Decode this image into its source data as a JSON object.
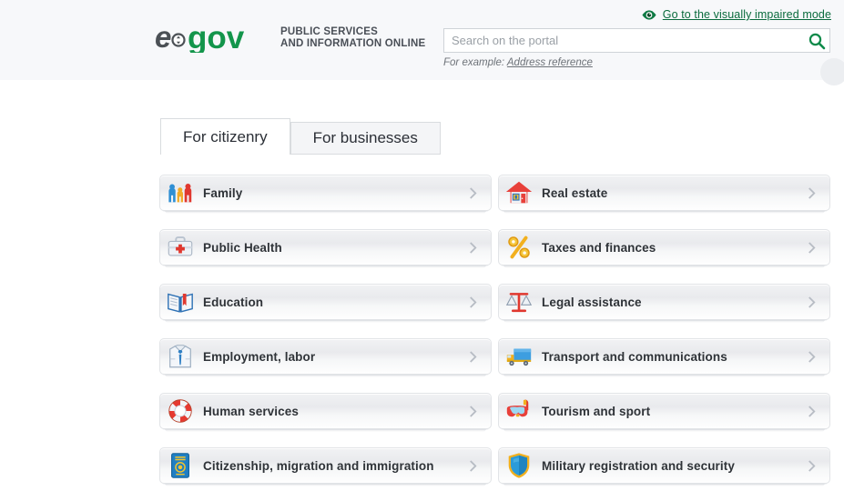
{
  "header": {
    "accessibility_link": {
      "label": "Go to the visually impaired mode",
      "icon": "eye-icon",
      "color": "#0a6b3d"
    },
    "logo": {
      "text_e": "e",
      "text_gov": "gov",
      "color_e": "#4b5055",
      "color_gov": "#13954b",
      "tagline_line1": "PUBLIC SERVICES",
      "tagline_line2": "AND INFORMATION ONLINE"
    },
    "search": {
      "placeholder": "Search on the portal",
      "value": "",
      "button_icon": "search-icon",
      "button_color": "#0f8a4a",
      "hint_prefix": "For example:",
      "hint_link": "Address reference"
    }
  },
  "main": {
    "tabs": [
      {
        "label": "For citizenry",
        "active": true
      },
      {
        "label": "For businesses",
        "active": false
      }
    ],
    "menu_items_left": [
      {
        "label": "Family",
        "icon": "family-icon",
        "chevron": "chevron-right-icon"
      },
      {
        "label": "Public Health",
        "icon": "medical-bag-icon",
        "chevron": "chevron-right-icon"
      },
      {
        "label": "Education",
        "icon": "open-book-icon",
        "chevron": "chevron-right-icon"
      },
      {
        "label": "Employment, labor",
        "icon": "shirt-tie-icon",
        "chevron": "chevron-right-icon"
      },
      {
        "label": "Human services",
        "icon": "lifebuoy-icon",
        "chevron": "chevron-right-icon"
      },
      {
        "label": "Citizenship, migration and immigration",
        "icon": "passport-icon",
        "chevron": "chevron-right-icon"
      }
    ],
    "menu_items_right": [
      {
        "label": "Real estate",
        "icon": "house-icon",
        "chevron": "chevron-right-icon"
      },
      {
        "label": "Taxes and finances",
        "icon": "percent-icon",
        "chevron": "chevron-right-icon"
      },
      {
        "label": "Legal assistance",
        "icon": "scales-icon",
        "chevron": "chevron-right-icon"
      },
      {
        "label": "Transport and communications",
        "icon": "truck-icon",
        "chevron": "chevron-right-icon"
      },
      {
        "label": "Tourism and sport",
        "icon": "diving-mask-icon",
        "chevron": "chevron-right-icon"
      },
      {
        "label": "Military registration and security",
        "icon": "shield-icon",
        "chevron": "chevron-right-icon"
      }
    ]
  },
  "colors": {
    "header_bg": "#f7f8fa",
    "brand_green": "#13954b",
    "link_green": "#0a6b3d",
    "text_dark": "#2f3338"
  }
}
